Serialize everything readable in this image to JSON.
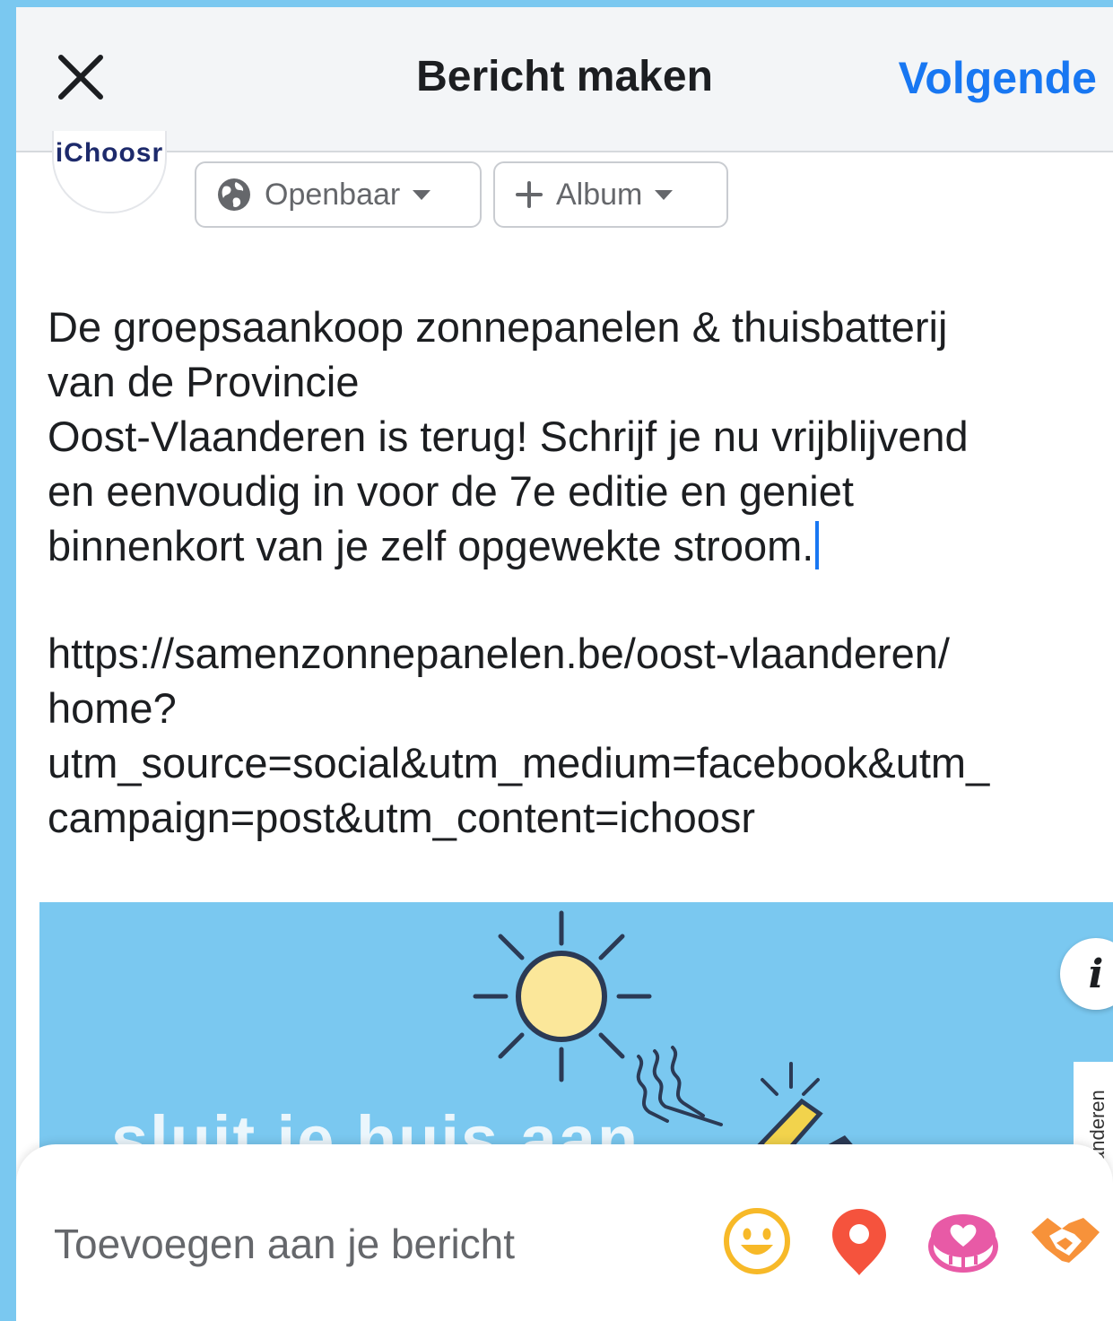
{
  "header": {
    "title": "Bericht maken",
    "next_label": "Volgende",
    "close_icon": "close-icon"
  },
  "author": {
    "avatar_text": "iChoosr",
    "audience_label": "Openbaar",
    "album_label": "Album"
  },
  "post": {
    "text": "De groepsaankoop zonnepanelen & thuisbatterij\nvan de Provincie\nOost-Vlaanderen is terug! Schrijf je nu vrijblijvend\nen eenvoudig in voor de 7e editie en geniet\nbinnenkort van je zelf opgewekte stroom.",
    "link": "https://samenzonnepanelen.be/oost-vlaanderen/\nhome?\nutm_source=social&utm_medium=facebook&utm_\ncampaign=post&utm_content=ichoosr"
  },
  "preview": {
    "headline": "sluit je huis aan",
    "side_label": "anderen",
    "info_label": "i"
  },
  "add_to_post": {
    "label": "Toevoegen aan je bericht",
    "icons": [
      "emoji-icon",
      "location-pin-icon",
      "support-heart-icon",
      "handshake-icon"
    ]
  },
  "colors": {
    "accent": "#1877f2",
    "background_blue": "#7ac8f0",
    "sun_yellow": "#fbe79a",
    "emoji_yellow": "#f7b928",
    "location_red": "#f5533d",
    "heart_pink": "#e85aa6",
    "handshake_orange": "#f7923a"
  }
}
